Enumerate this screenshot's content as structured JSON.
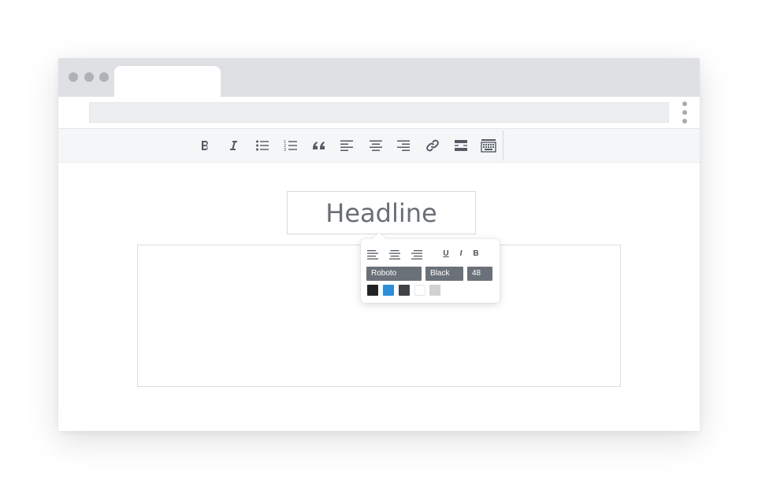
{
  "editor": {
    "headline": "Headline"
  },
  "toolbar": {
    "tools": [
      "bold-icon",
      "italic-icon",
      "bullet-list-icon",
      "numbered-list-icon",
      "quote-icon",
      "align-left-icon",
      "align-center-icon",
      "align-right-icon",
      "link-icon",
      "horizontal-rule-icon",
      "keyboard-icon"
    ]
  },
  "popup": {
    "underline_label": "U",
    "italic_label": "I",
    "bold_label": "B",
    "font_family": "Roboto",
    "font_weight": "Black",
    "font_size": "48",
    "swatches": [
      "#202224",
      "#2e8fd8",
      "#404346",
      "#ffffff",
      "#cfd1d3"
    ]
  }
}
